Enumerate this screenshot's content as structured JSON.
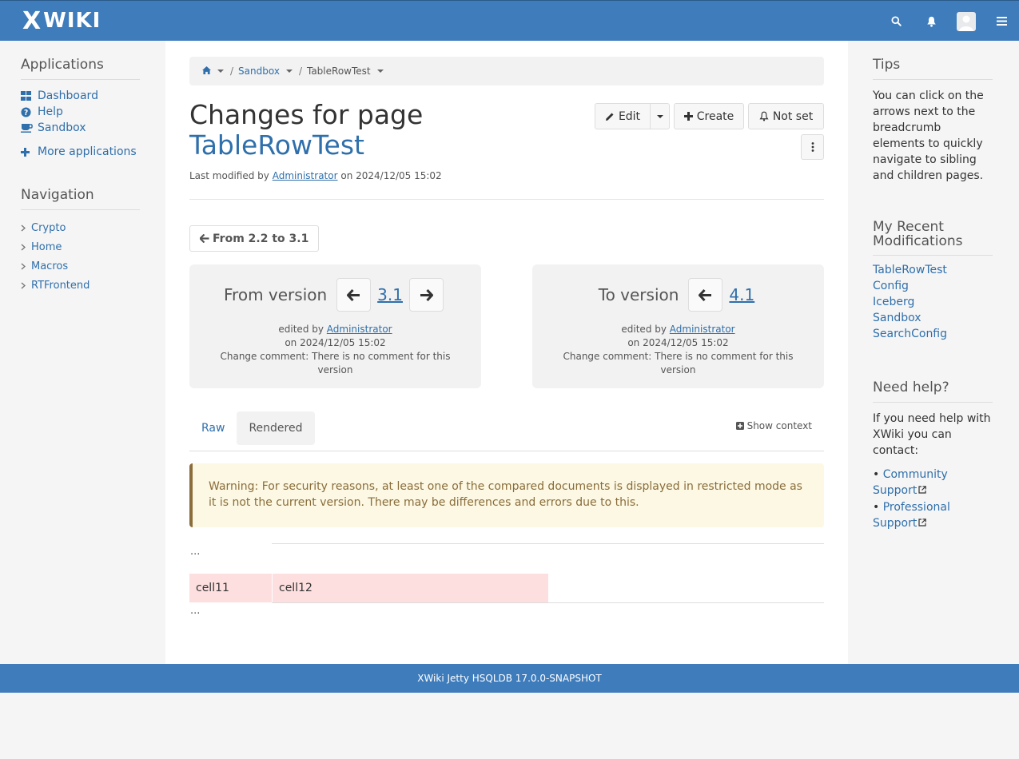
{
  "header": {
    "logo_text": "WIKI",
    "logo_mark": "X",
    "icons": [
      "search-icon",
      "bell-icon",
      "avatar",
      "menu-icon"
    ]
  },
  "left": {
    "applications_title": "Applications",
    "applications": [
      {
        "label": "Dashboard",
        "icon": "dashboard-icon"
      },
      {
        "label": "Help",
        "icon": "question-icon"
      },
      {
        "label": "Sandbox",
        "icon": "coffee-icon"
      }
    ],
    "more_applications": "More applications",
    "navigation_title": "Navigation",
    "navigation": [
      "Crypto",
      "Home",
      "Macros",
      "RTFrontend"
    ]
  },
  "breadcrumb": {
    "items": [
      "Sandbox",
      "TableRowTest"
    ]
  },
  "page": {
    "title_prefix": "Changes for page",
    "title_doc": "TableRowTest",
    "meta_prefix": "Last modified by",
    "meta_user": "Administrator",
    "meta_on": "on 2024/12/05 15:02"
  },
  "actions": {
    "edit": "Edit",
    "create": "Create",
    "watch": "Not set"
  },
  "compare": {
    "from_to_label": "From 2.2 to 3.1",
    "from": {
      "label": "From version",
      "version": "3.1",
      "edited_by_prefix": "edited by",
      "user": "Administrator",
      "date": "on 2024/12/05 15:02",
      "comment": "Change comment: There is no comment for this version"
    },
    "to": {
      "label": "To version",
      "version": "4.1",
      "edited_by_prefix": "edited by",
      "user": "Administrator",
      "date": "on 2024/12/05 15:02",
      "comment": "Change comment: There is no comment for this version"
    }
  },
  "tabs": {
    "raw": "Raw",
    "rendered": "Rendered",
    "show_context": "Show context"
  },
  "warning": "Warning: For security reasons, at least one of the compared documents is displayed in restricted mode as it is not the current version. There may be differences and errors due to this.",
  "diff": {
    "ellipsis": "...",
    "cells": [
      "cell11",
      "cell12"
    ]
  },
  "right": {
    "tips_title": "Tips",
    "tips_text": "You can click on the arrows next to the breadcrumb elements to quickly navigate to sibling and children pages.",
    "recent_title": "My Recent Modifications",
    "recent": [
      "TableRowTest",
      "Config",
      "Iceberg",
      "Sandbox",
      "SearchConfig"
    ],
    "help_title": "Need help?",
    "help_text": "If you need help with XWiki you can contact:",
    "community": "Community Support",
    "professional": "Professional Support"
  },
  "footer": {
    "text": "XWiki Jetty HSQLDB 17.0.0-SNAPSHOT"
  },
  "colors": {
    "brand": "#3e7cbc",
    "link": "#2f6fab",
    "warning_bg": "#fcf8e3",
    "warning_text": "#8a6d3b",
    "diff_removed": "#fddfdf"
  }
}
